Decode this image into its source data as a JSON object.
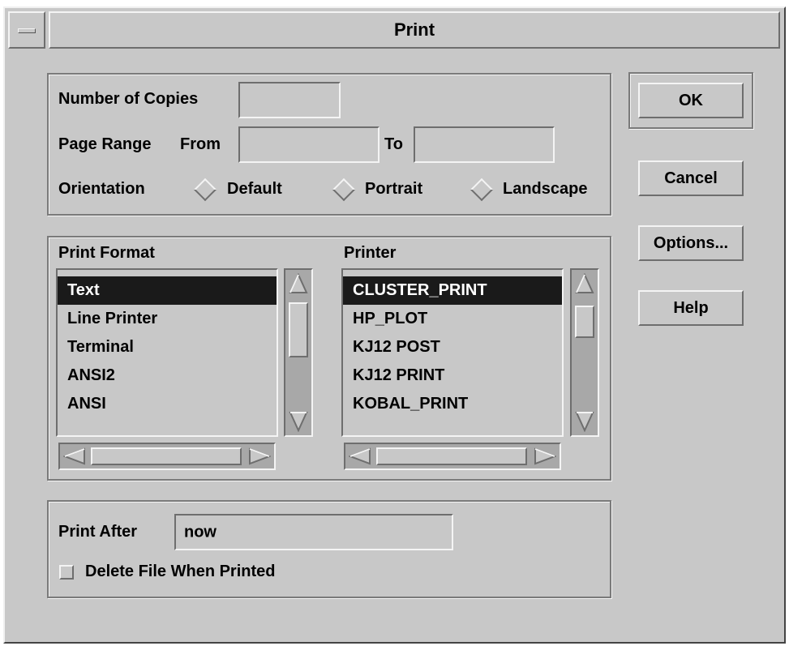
{
  "window": {
    "title": "Print"
  },
  "copies": {
    "label": "Number of Copies",
    "value": ""
  },
  "page_range": {
    "label": "Page Range",
    "from_label": "From",
    "from_value": "",
    "to_label": "To",
    "to_value": ""
  },
  "orientation": {
    "label": "Orientation",
    "options": [
      "Default",
      "Portrait",
      "Landscape"
    ],
    "selected": null
  },
  "print_format": {
    "label": "Print Format",
    "items": [
      "Text",
      "Line Printer",
      "Terminal",
      "ANSI2",
      "ANSI"
    ],
    "selected": "Text"
  },
  "printer": {
    "label": "Printer",
    "items": [
      "CLUSTER_PRINT",
      "HP_PLOT",
      "KJ12 POST",
      "KJ12 PRINT",
      "KOBAL_PRINT"
    ],
    "selected": "CLUSTER_PRINT"
  },
  "print_after": {
    "label": "Print After",
    "value": "now"
  },
  "delete_file": {
    "label": "Delete File When Printed",
    "checked": false
  },
  "buttons": {
    "ok": "OK",
    "cancel": "Cancel",
    "options": "Options...",
    "help": "Help"
  },
  "colors": {
    "background": "#c8c8c8",
    "selection": "#1a1a1a",
    "trough": "#a8a8a8"
  },
  "icons": {
    "window_menu": "window-menu-icon",
    "up": "arrow-up-icon",
    "down": "arrow-down-icon",
    "left": "arrow-left-icon",
    "right": "arrow-right-icon"
  }
}
